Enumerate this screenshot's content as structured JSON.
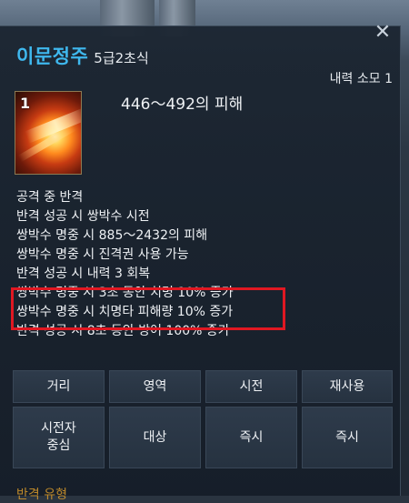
{
  "tooltip": {
    "close_symbol": "✕",
    "skill_name": "이문정주",
    "skill_rank": "5급2초식",
    "resource_cost": "내력 소모 1",
    "icon_number": "1",
    "icon": "flame-strike-icon",
    "damage": "446～492의 피해",
    "effects": [
      "공격 중  반격",
      "반격 성공 시  쌍박수 시전",
      "쌍박수 명중 시  885～2432의 피해",
      "쌍박수 명중 시  진격권 사용 가능",
      "반격 성공 시  내력 3 회복",
      "쌍박수 명중 시  3초 동안 치명 10% 증가",
      "쌍박수 명중 시  치명타 피해량 10% 증가",
      "반격 성공 시  8초 동안 방어 100% 증가"
    ],
    "highlight_color": "#e01822",
    "info_grid": {
      "row1": [
        "거리",
        "영역",
        "시전",
        "재사용"
      ],
      "row2": [
        "시전자\n중심",
        "대상",
        "즉시",
        "즉시"
      ]
    },
    "next_section_peek": "반격 유형"
  }
}
